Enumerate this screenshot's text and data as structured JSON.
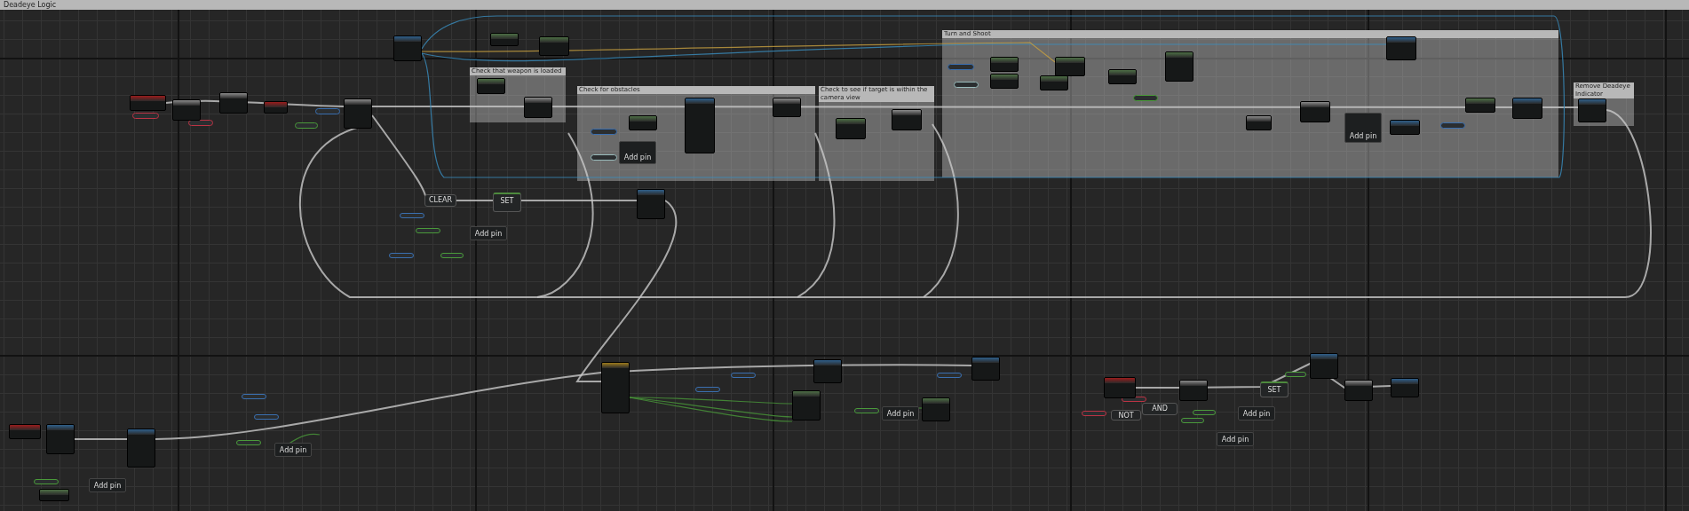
{
  "graph_title": "Deadeye Logic",
  "comments": [
    {
      "title": "Check that weapon is loaded"
    },
    {
      "title": "Check for obstacles"
    },
    {
      "title": "Check to see if target is within the camera view"
    },
    {
      "title": "Turn and Shoot"
    },
    {
      "title": "Remove Deadeye Indicator"
    }
  ],
  "node_labels": [
    "CLEAR",
    "SET",
    "AND",
    "NOT",
    "SET"
  ],
  "add_pin_labels": [
    "Add pin",
    "Add pin",
    "Add pin",
    "Add pin",
    "Add pin",
    "Add pin",
    "Add pin",
    "Add pin"
  ]
}
